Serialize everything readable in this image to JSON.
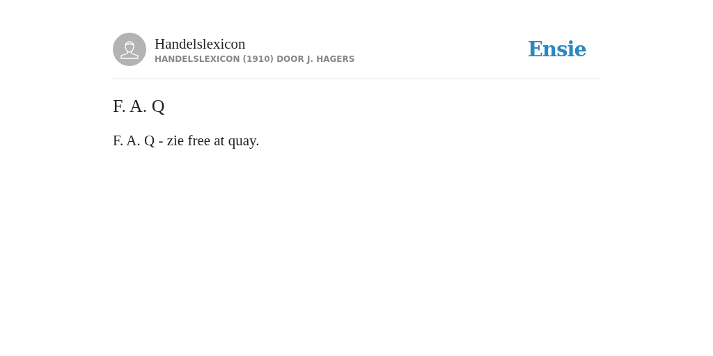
{
  "header": {
    "title": "Handelslexicon",
    "subtitle": "HANDELSLEXICON (1910) DOOR J. HAGERS",
    "logo": "Ensie"
  },
  "entry": {
    "heading": "F. A. Q",
    "body": "F. A. Q - zie free at quay."
  }
}
